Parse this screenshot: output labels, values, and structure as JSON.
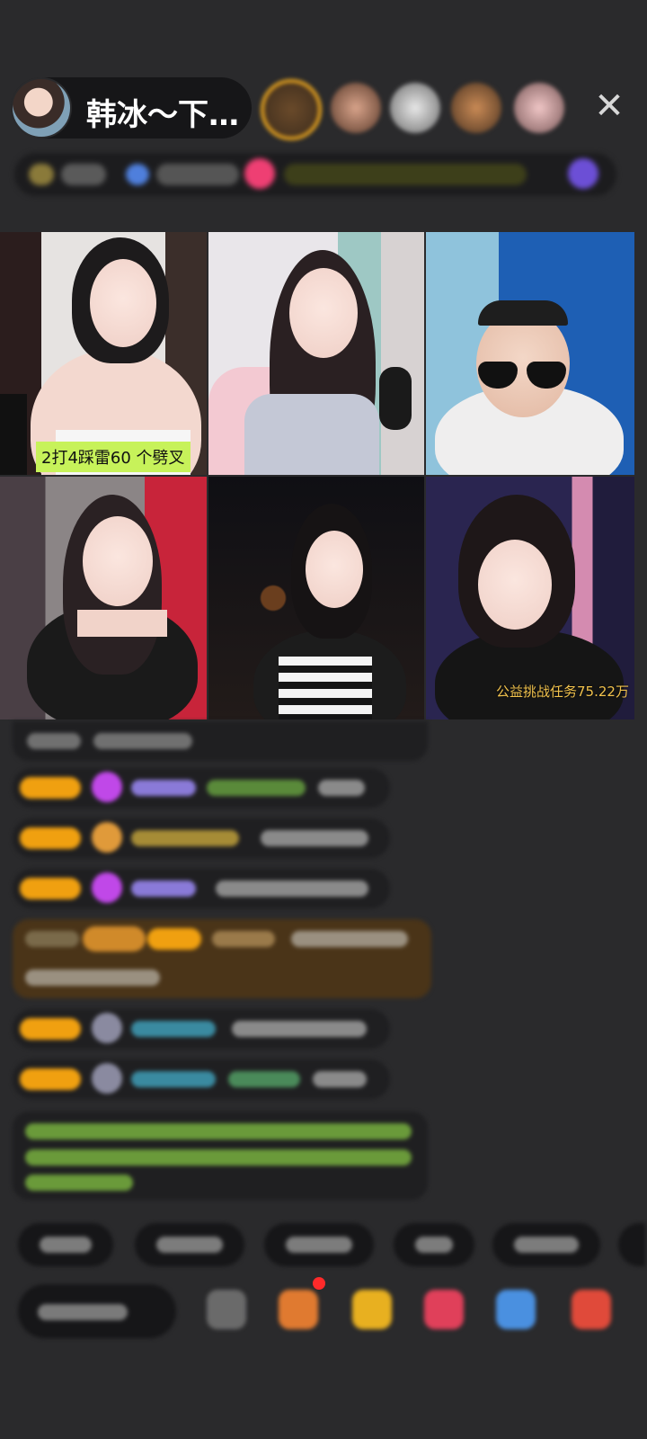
{
  "header": {
    "host_name": "韩冰～下…",
    "close_icon": "close-icon"
  },
  "video": {
    "caption_left": "2打4踩雷60 个劈叉",
    "caption_right": "公益挑战任务75.22万"
  },
  "colors": {
    "background": "#2a2a2c",
    "level_badge": "#f0a010",
    "caption_bg": "#c7f25a",
    "task_text": "#f1c24d"
  }
}
